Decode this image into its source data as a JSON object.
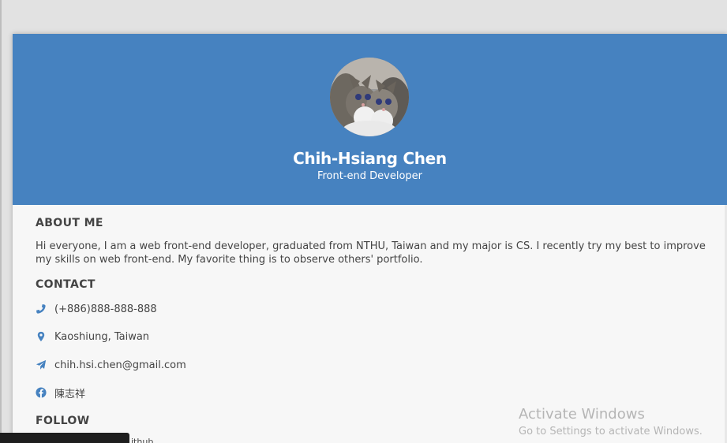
{
  "profile": {
    "name": "Chih-Hsiang Chen",
    "role": "Front-end Developer"
  },
  "about": {
    "title": "ABOUT ME",
    "text": "Hi everyone, I am a web front-end developer, graduated from NTHU, Taiwan and my major is CS. I recently try my best to improve my skills on web front-end. My favorite thing is to observe others' portfolio."
  },
  "contact": {
    "title": "CONTACT",
    "items": [
      {
        "icon": "phone-icon",
        "text": "(+886)888-888-888"
      },
      {
        "icon": "map-pin-icon",
        "text": "Kaoshiung, Taiwan"
      },
      {
        "icon": "paper-plane-icon",
        "text": "chih.hsi.chen@gmail.com"
      },
      {
        "icon": "facebook-icon",
        "text": "陳志祥"
      }
    ]
  },
  "follow": {
    "title": "FOLLOW",
    "peek_text": "ithub"
  },
  "watermark": {
    "line1": "Activate Windows",
    "line2": "Go to Settings to activate Windows."
  },
  "colors": {
    "hero": "#4682c0",
    "icon": "#4682c0",
    "background": "#e2e2e2",
    "card": "#f7f7f7"
  }
}
